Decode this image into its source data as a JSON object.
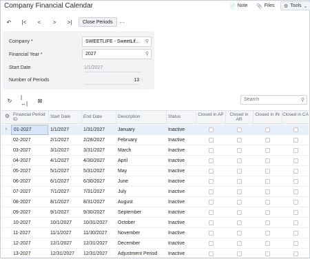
{
  "header": {
    "title": "Company Financial Calendar",
    "note_label": "Note",
    "files_label": "Files",
    "tools_label": "Tools"
  },
  "toolbar": {
    "close_periods_label": "Close Periods",
    "more_label": "···"
  },
  "form": {
    "company_label": "Company *",
    "company_value": "SWEETLIFE - SweetLif...",
    "year_label": "Financial Year *",
    "year_value": "2027",
    "start_date_label": "Start Date",
    "start_date_value": "1/1/2027",
    "periods_label": "Number of Periods",
    "periods_value": "13"
  },
  "search": {
    "placeholder": "Search"
  },
  "grid": {
    "columns": [
      "Financial Period ID",
      "Start Date",
      "End Date",
      "Description",
      "Status",
      "Closed in AP",
      "Closed in AR",
      "Closed in IN",
      "Closed in CA"
    ],
    "rows": [
      {
        "id": "01-2027",
        "start": "1/1/2027",
        "end": "1/31/2027",
        "desc": "January",
        "status": "Inactive"
      },
      {
        "id": "02-2027",
        "start": "2/1/2027",
        "end": "2/28/2027",
        "desc": "February",
        "status": "Inactive"
      },
      {
        "id": "03-2027",
        "start": "3/1/2027",
        "end": "3/31/2027",
        "desc": "March",
        "status": "Inactive"
      },
      {
        "id": "04-2027",
        "start": "4/1/2027",
        "end": "4/30/2027",
        "desc": "April",
        "status": "Inactive"
      },
      {
        "id": "05-2027",
        "start": "5/1/2027",
        "end": "5/31/2027",
        "desc": "May",
        "status": "Inactive"
      },
      {
        "id": "06-2027",
        "start": "6/1/2027",
        "end": "6/30/2027",
        "desc": "June",
        "status": "Inactive"
      },
      {
        "id": "07-2027",
        "start": "7/1/2027",
        "end": "7/31/2027",
        "desc": "July",
        "status": "Inactive"
      },
      {
        "id": "08-2027",
        "start": "8/1/2027",
        "end": "8/31/2027",
        "desc": "August",
        "status": "Inactive"
      },
      {
        "id": "09-2027",
        "start": "9/1/2027",
        "end": "9/30/2027",
        "desc": "September",
        "status": "Inactive"
      },
      {
        "id": "10-2027",
        "start": "10/1/2027",
        "end": "10/31/2027",
        "desc": "October",
        "status": "Inactive"
      },
      {
        "id": "11-2027",
        "start": "11/1/2027",
        "end": "11/30/2027",
        "desc": "November",
        "status": "Inactive"
      },
      {
        "id": "12-2027",
        "start": "12/1/2027",
        "end": "12/31/2027",
        "desc": "December",
        "status": "Inactive"
      },
      {
        "id": "13-2027",
        "start": "12/31/2027",
        "end": "12/31/2027",
        "desc": "Adjustment Period",
        "status": "Inactive"
      }
    ]
  }
}
